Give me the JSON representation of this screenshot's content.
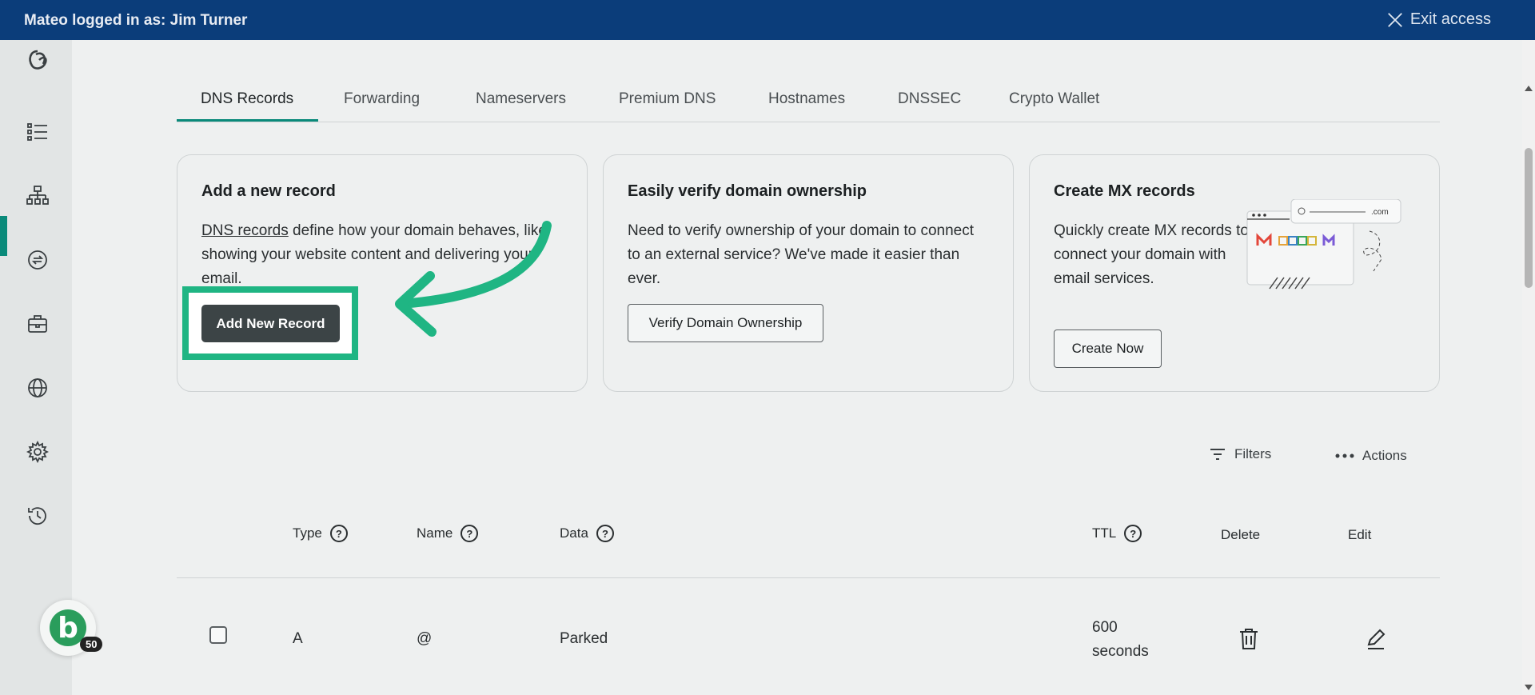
{
  "topbar": {
    "logged_in_text": "Mateo logged in as: Jim Turner",
    "exit_label": "Exit access"
  },
  "tabs": [
    {
      "label": "DNS Records"
    },
    {
      "label": "Forwarding"
    },
    {
      "label": "Nameservers"
    },
    {
      "label": "Premium DNS"
    },
    {
      "label": "Hostnames"
    },
    {
      "label": "DNSSEC"
    },
    {
      "label": "Crypto Wallet"
    }
  ],
  "cards": {
    "add": {
      "title": "Add a new record",
      "link_text": "DNS records",
      "body_rest": " define how your domain behaves, like showing your website content and delivering your email.",
      "button": "Add New Record"
    },
    "verify": {
      "title": "Easily verify domain ownership",
      "body": "Need to verify ownership of your domain to connect to an external service? We've made it easier than ever.",
      "button": "Verify Domain Ownership"
    },
    "mx": {
      "title": "Create MX records",
      "body": "Quickly create MX records to connect your domain with email services.",
      "button": "Create Now",
      "illustration_text": ".com"
    }
  },
  "toolbar": {
    "filters": "Filters",
    "actions": "Actions"
  },
  "table": {
    "headers": {
      "type": "Type",
      "name": "Name",
      "data": "Data",
      "ttl": "TTL",
      "delete": "Delete",
      "edit": "Edit"
    },
    "help_glyph": "?",
    "rows": [
      {
        "type": "A",
        "name": "@",
        "data": "Parked",
        "ttl_value": "600",
        "ttl_unit": "seconds"
      }
    ]
  },
  "badge": {
    "letter": "b",
    "count": "50"
  },
  "colors": {
    "topbar": "#0b3d7a",
    "accent": "#0a8a7a",
    "highlight": "#1fb583",
    "primary_button": "#3c4446"
  }
}
